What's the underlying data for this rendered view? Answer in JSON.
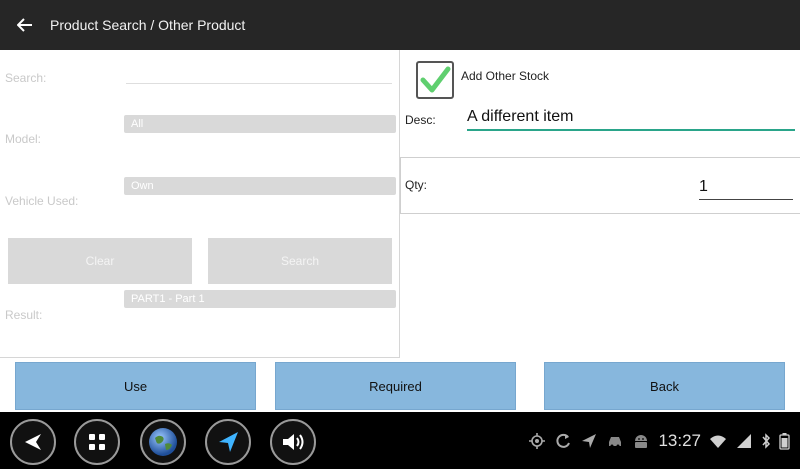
{
  "app": {
    "title": "Product Search / Other Product"
  },
  "search_form": {
    "search_label": "Search:",
    "search_value": "",
    "model_label": "Model:",
    "model_value": "All",
    "vehicle_label": "Vehicle Used:",
    "vehicle_value": "Own",
    "clear_label": "Clear",
    "search_button_label": "Search",
    "result_label": "Result:",
    "result_value": "PART1 - Part 1"
  },
  "other_stock": {
    "checkbox_label": "Add Other Stock",
    "checked": true,
    "desc_label": "Desc:",
    "desc_value": "A different item",
    "qty_label": "Qty:",
    "qty_value": "1"
  },
  "actions": {
    "use_label": "Use",
    "required_label": "Required",
    "back_label": "Back"
  },
  "status_bar": {
    "time": "13:27"
  },
  "colors": {
    "appbar_bg": "#262626",
    "button_bg": "#87b7dd",
    "accent_underline": "#2aa58a",
    "check_green": "#5fcf6f"
  },
  "icons": {
    "back": "arrow-left-icon",
    "nav": [
      "back-triangle-icon",
      "home-grid-icon",
      "globe-icon",
      "navigation-arrow-icon",
      "volume-icon"
    ],
    "status": [
      "location-icon",
      "sync-icon",
      "gps-arrow-icon",
      "car-icon",
      "android-icon",
      "wifi-icon",
      "bluetooth-icon",
      "battery-icon"
    ]
  }
}
